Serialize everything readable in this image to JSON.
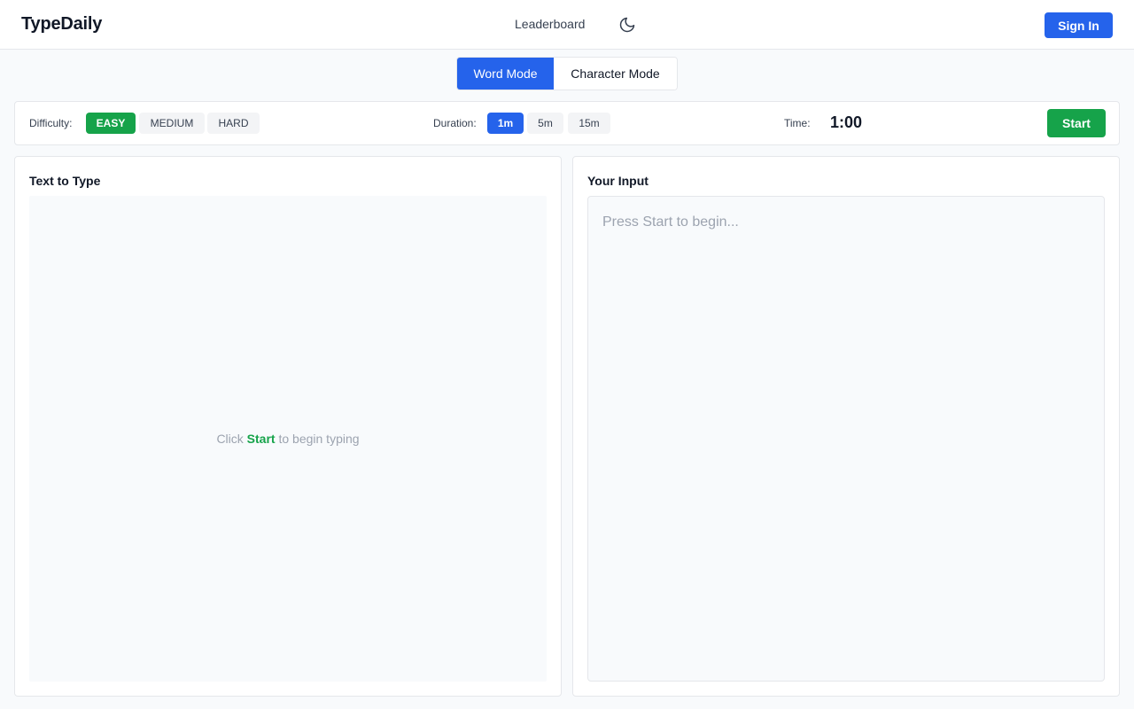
{
  "header": {
    "logo": "TypeDaily",
    "nav": {
      "leaderboard": "Leaderboard"
    },
    "theme_icon": "moon-icon",
    "signin_label": "Sign In"
  },
  "modes": {
    "word": "Word Mode",
    "character": "Character Mode",
    "active": "word"
  },
  "controls": {
    "difficulty_label": "Difficulty:",
    "difficulty_options": [
      "EASY",
      "MEDIUM",
      "HARD"
    ],
    "difficulty_selected": "EASY",
    "duration_label": "Duration:",
    "duration_options": [
      "1m",
      "5m",
      "15m"
    ],
    "duration_selected": "1m",
    "time_label": "Time:",
    "time_value": "1:00",
    "start_label": "Start"
  },
  "text_panel": {
    "title": "Text to Type",
    "prompt_before": "Click",
    "prompt_highlight": "Start",
    "prompt_after": "to begin typing"
  },
  "input_panel": {
    "title": "Your Input",
    "placeholder": "Press Start to begin...",
    "value": ""
  },
  "colors": {
    "primary": "#2563eb",
    "success": "#16a34a",
    "muted": "#9ca3af",
    "border": "#e5e7eb",
    "surface": "#f8fafc"
  }
}
